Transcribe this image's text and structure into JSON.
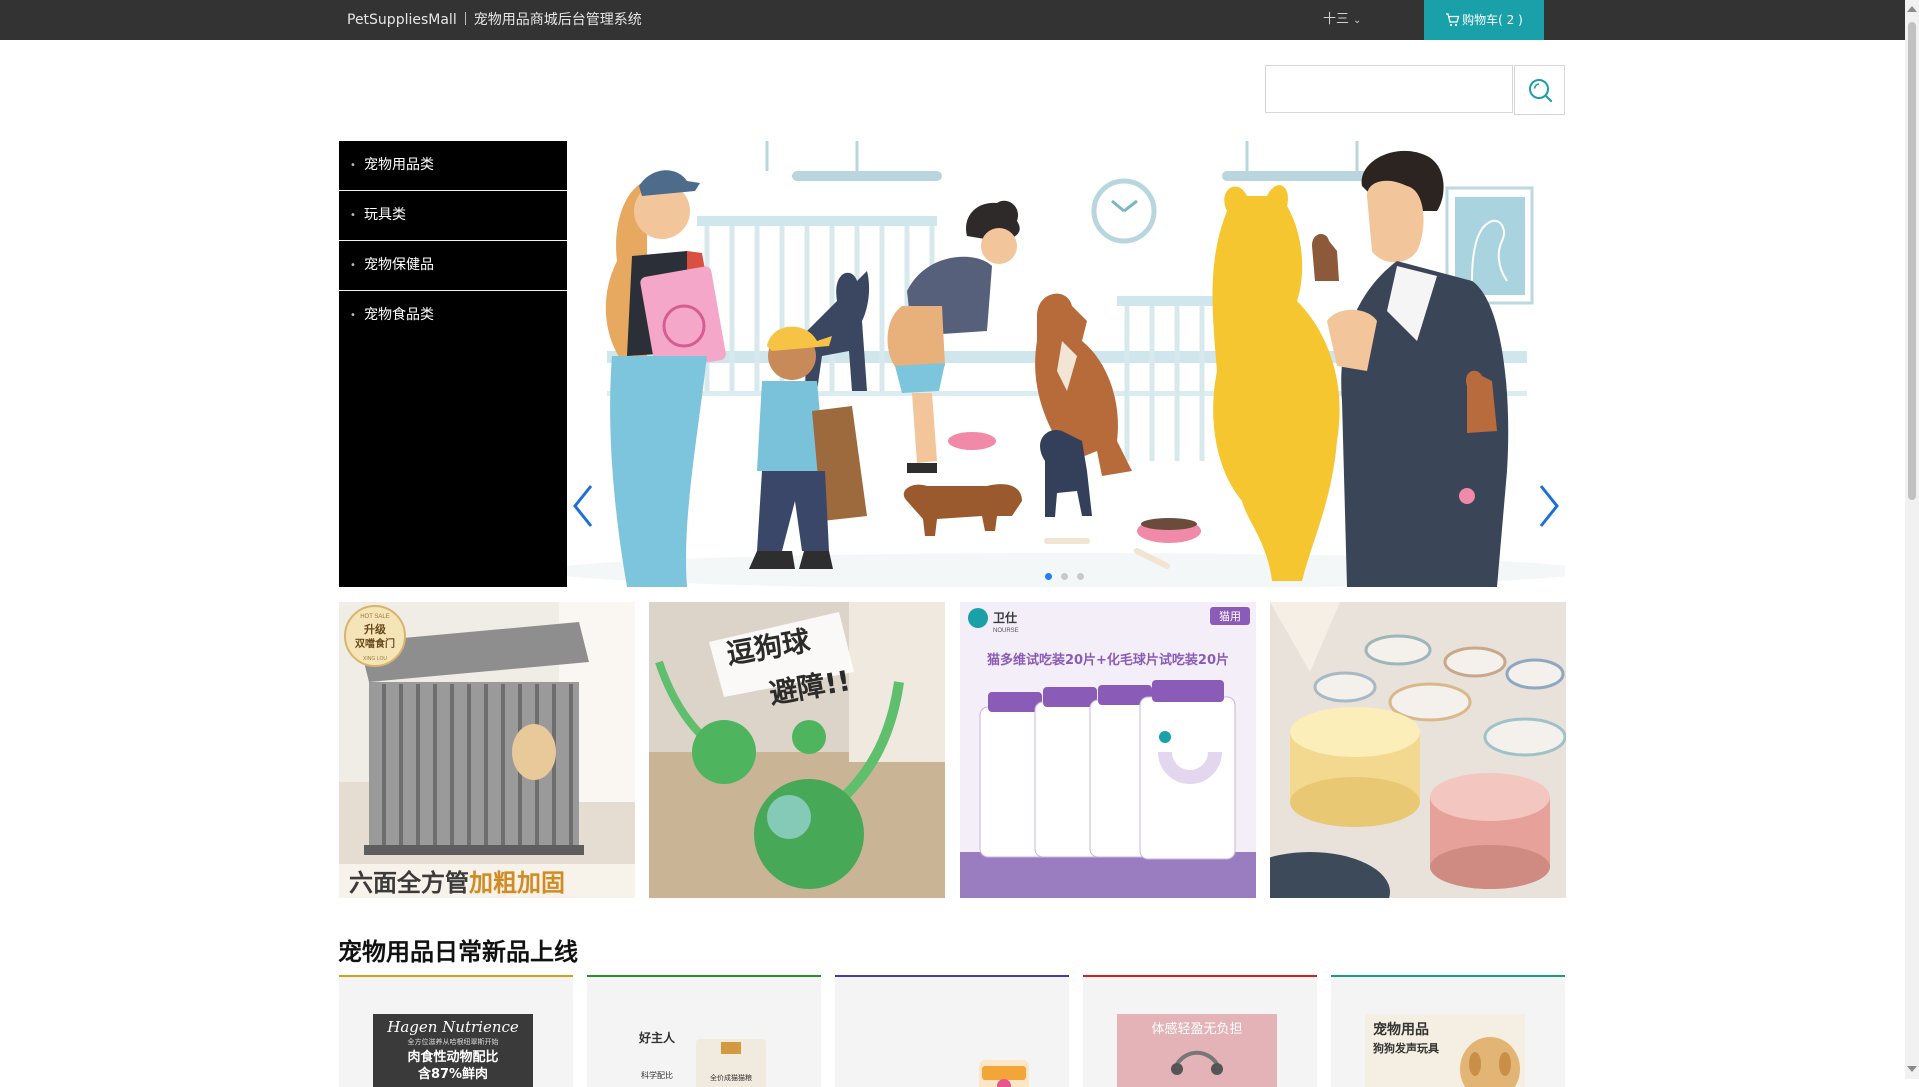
{
  "header": {
    "brand": "PetSuppliesMall",
    "system_title": "宠物用品商城后台管理系统",
    "user_name": "十三",
    "cart_label": "购物车( 2 )"
  },
  "search": {
    "value": "",
    "placeholder": ""
  },
  "categories": [
    {
      "label": "宠物用品类"
    },
    {
      "label": "玩具类"
    },
    {
      "label": "宠物保健品"
    },
    {
      "label": "宠物食品类"
    }
  ],
  "carousel": {
    "total_slides": 3,
    "active_index": 0
  },
  "promos": [
    {
      "badge_top": "HOT SALE",
      "badge_main": "升级",
      "badge_sub": "双噹食门",
      "badge_bottom": "XING LOU",
      "caption_a": "六面全方管",
      "caption_b": "加粗加固"
    },
    {
      "headline": "逗狗球",
      "headline2": "避障!!"
    },
    {
      "brand": "卫仕",
      "brand_en": "NOURSE",
      "tag": "猫用",
      "headline": "猫多维试吃装20片+化毛球片试吃装20片"
    },
    {}
  ],
  "section": {
    "title": "宠物用品日常新品上线"
  },
  "products": [
    {
      "accent": "#d4a017",
      "img_title": "Hagen Nutrience",
      "img_sub": "全方位滋养从哈根纽翠斯开始",
      "img_line1": "肉食性动物配比",
      "img_line2": "含87%鲜肉"
    },
    {
      "accent": "#2e8b2e",
      "img_title": "好主人",
      "img_sub": "科学配比",
      "img_line1": "全价成猫猫粮"
    },
    {
      "accent": "#4a3aa8",
      "img_title": ""
    },
    {
      "accent": "#d62020",
      "img_title": "体感轻盈无负担"
    },
    {
      "accent": "#18a07e",
      "img_title": "宠物用品",
      "img_sub": "狗狗发声玩具"
    }
  ],
  "colors": {
    "topbar": "#333333",
    "cart": "#1aa0a8",
    "sidebar": "#000000",
    "dot_active": "#1e80ff"
  }
}
